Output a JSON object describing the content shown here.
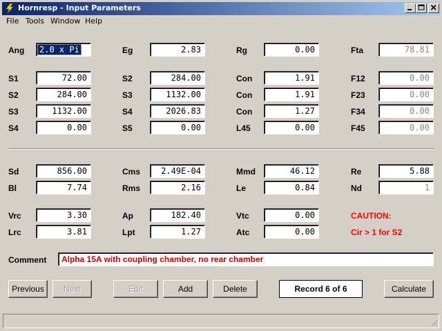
{
  "window": {
    "title": "Hornresp - Input Parameters"
  },
  "menu": [
    "File",
    "Tools",
    "Window",
    "Help"
  ],
  "row1": {
    "ang_label": "Ang",
    "ang_value": "2.0 x Pi",
    "eg_label": "Eg",
    "eg_value": "2.83",
    "rg_label": "Rg",
    "rg_value": "0.00",
    "fta_label": "Fta",
    "fta_value": "78.81"
  },
  "horn": {
    "col1": [
      {
        "label": "S1",
        "value": "72.00"
      },
      {
        "label": "S2",
        "value": "284.00"
      },
      {
        "label": "S3",
        "value": "1132.00"
      },
      {
        "label": "S4",
        "value": "0.00"
      }
    ],
    "col2": [
      {
        "label": "S2",
        "value": "284.00"
      },
      {
        "label": "S3",
        "value": "1132.00"
      },
      {
        "label": "S4",
        "value": "2026.83"
      },
      {
        "label": "S5",
        "value": "0.00"
      }
    ],
    "col3": [
      {
        "label": "Con",
        "value": "1.91"
      },
      {
        "label": "Con",
        "value": "1.91"
      },
      {
        "label": "Con",
        "value": "1.27"
      },
      {
        "label": "L45",
        "value": "0.00"
      }
    ],
    "col4": [
      {
        "label": "F12",
        "value": "0.00"
      },
      {
        "label": "F23",
        "value": "0.00"
      },
      {
        "label": "F34",
        "value": "0.00"
      },
      {
        "label": "F45",
        "value": "0.00"
      }
    ]
  },
  "driver": {
    "sd_label": "Sd",
    "sd_value": "856.00",
    "cms_label": "Cms",
    "cms_value": "2.49E-04",
    "mmd_label": "Mmd",
    "mmd_value": "46.12",
    "re_label": "Re",
    "re_value": "5.88",
    "bl_label": "Bl",
    "bl_value": "7.74",
    "rms_label": "Rms",
    "rms_value": "2.16",
    "le_label": "Le",
    "le_value": "0.84",
    "nd_label": "Nd",
    "nd_value": "1"
  },
  "chambers": {
    "vrc_label": "Vrc",
    "vrc_value": "3.30",
    "ap_label": "Ap",
    "ap_value": "182.40",
    "vtc_label": "Vtc",
    "vtc_value": "0.00",
    "lrc_label": "Lrc",
    "lrc_value": "3.81",
    "lpt_label": "Lpt",
    "lpt_value": "1.27",
    "atc_label": "Atc",
    "atc_value": "0.00"
  },
  "caution": {
    "title": "CAUTION:",
    "message": "Cir > 1 for S2"
  },
  "comment": {
    "label": "Comment",
    "value": "Alpha 15A with coupling chamber, no rear chamber"
  },
  "buttons": {
    "previous": "Previous",
    "next": "Next",
    "edit": "Edit",
    "add": "Add",
    "delete": "Delete",
    "calculate": "Calculate"
  },
  "record": "Record 6 of 6",
  "colors": {
    "caution": "#ff0000",
    "comment_text": "#cc0000",
    "title_gradient_start": "#0a246a",
    "title_gradient_end": "#a6caf0"
  }
}
